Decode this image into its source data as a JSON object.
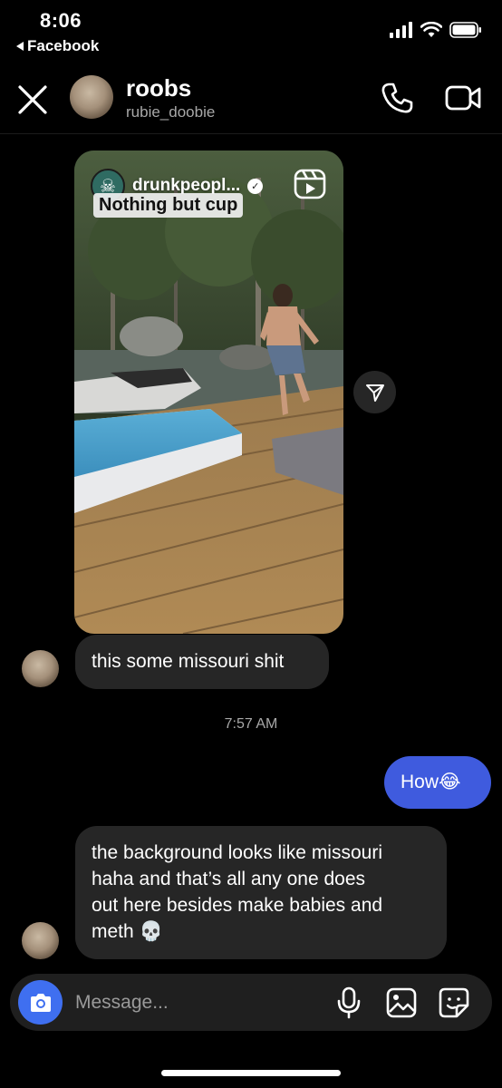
{
  "status_bar": {
    "time": "8:06",
    "back_app": "Facebook"
  },
  "header": {
    "name": "roobs",
    "username": "rubie_doobie"
  },
  "reel": {
    "account": "drunkpeopl...",
    "caption": "Nothing but cup"
  },
  "messages": [
    {
      "from": "them",
      "text": "this some missouri shit"
    },
    {
      "from": "me",
      "text": "How😂"
    },
    {
      "from": "them",
      "lines": [
        "the background looks like missouri",
        "haha and that’s all any one does",
        "out here besides make babies and",
        "meth 💀"
      ]
    }
  ],
  "timestamp": "7:57 AM",
  "composer": {
    "placeholder": "Message..."
  },
  "colors": {
    "outgoing_bubble": "#3f5bde",
    "incoming_bubble": "#262626",
    "camera_button": "#3f6ff0",
    "background": "#000000"
  },
  "icons": [
    "close-icon",
    "phone-icon",
    "video-camera-icon",
    "reels-icon",
    "share-icon",
    "camera-icon",
    "microphone-icon",
    "gallery-icon",
    "sticker-icon",
    "verified-icon"
  ]
}
